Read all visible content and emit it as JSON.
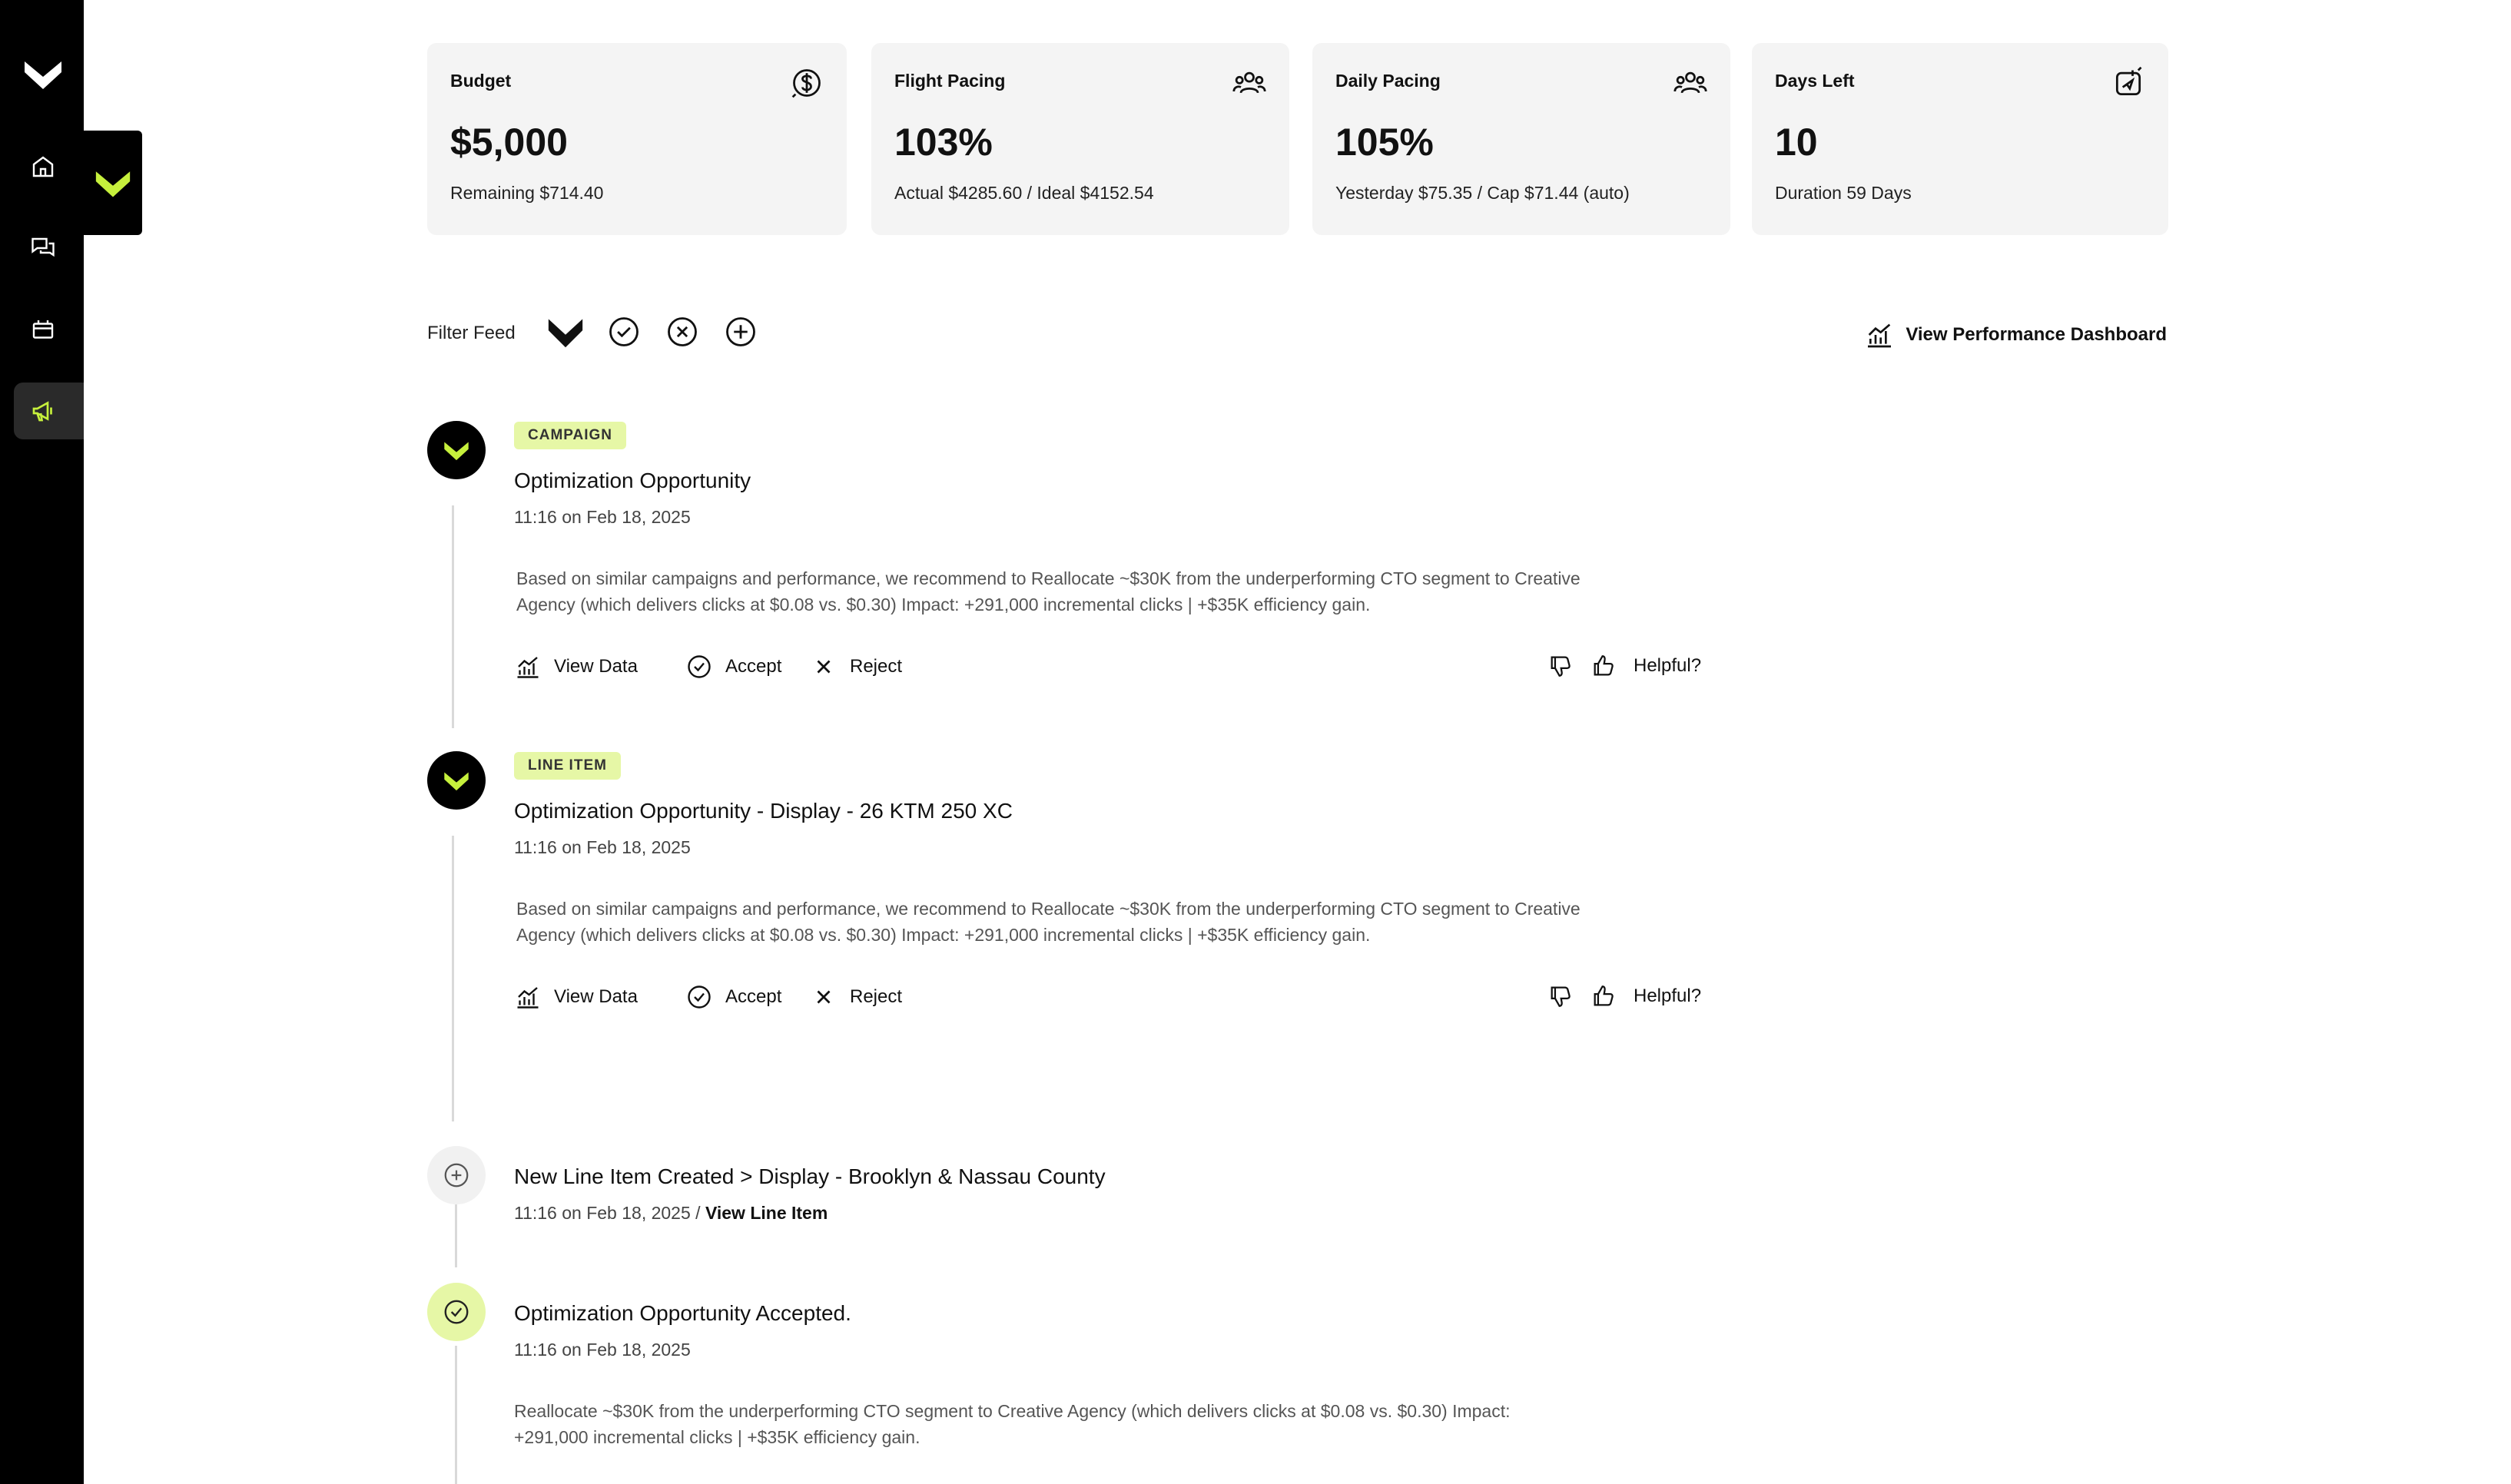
{
  "stats": [
    {
      "title": "Budget",
      "icon": "dollar-circle-icon",
      "value": "$5,000",
      "sub": "Remaining $714.40"
    },
    {
      "title": "Flight Pacing",
      "icon": "users-group-icon",
      "value": "103%",
      "sub": "Actual $4285.60 / Ideal $4152.54"
    },
    {
      "title": "Daily Pacing",
      "icon": "users-group-icon",
      "value": "105%",
      "sub": "Yesterday $75.35 / Cap $71.44 (auto)"
    },
    {
      "title": "Days Left",
      "icon": "calendar-send-icon",
      "value": "10",
      "sub": "Duration 59 Days"
    }
  ],
  "filter": {
    "label": "Filter Feed",
    "icons": [
      "brand-logo-icon",
      "check-circle-icon",
      "x-circle-icon",
      "plus-circle-icon"
    ],
    "dashboard_link": "View Performance Dashboard"
  },
  "feed": [
    {
      "tag": "CAMPAIGN",
      "title": "Optimization Opportunity",
      "time": "11:16 on Feb 18, 2025",
      "body_line1": "Based on similar campaigns and performance, we recommend to Reallocate ~$30K from the underperforming CTO segment to Creative",
      "body_line2": "Agency (which delivers clicks at $0.08 vs. $0.30) Impact: +291,000 incremental clicks | +$35K efficiency gain.",
      "view_data": "View Data",
      "accept": "Accept",
      "reject": "Reject",
      "helpful": "Helpful?"
    },
    {
      "tag": "LINE ITEM",
      "title": "Optimization Opportunity - Display - 26 KTM 250 XC",
      "time": "11:16 on Feb 18, 2025",
      "body_line1": "Based on similar campaigns and performance, we recommend to Reallocate ~$30K from the underperforming CTO segment to Creative",
      "body_line2": "Agency (which delivers clicks at $0.08 vs. $0.30) Impact: +291,000 incremental clicks | +$35K efficiency gain.",
      "view_data": "View Data",
      "accept": "Accept",
      "reject": "Reject",
      "helpful": "Helpful?"
    },
    {
      "title": "New Line Item Created > Display - Brooklyn & Nassau County",
      "time": "11:16 on Feb 18, 2025 /",
      "link": "View Line Item"
    },
    {
      "title": "Optimization Opportunity Accepted.",
      "time": "11:16 on Feb 18, 2025",
      "body_line1": "Reallocate ~$30K from the underperforming CTO segment to Creative Agency (which delivers clicks at $0.08 vs. $0.30) Impact:",
      "body_line2": "+291,000 incremental clicks | +$35K efficiency gain."
    }
  ],
  "colors": {
    "accent": "#c6f03c",
    "tag_bg": "#e6f7a6",
    "sidebar": "#000000"
  }
}
